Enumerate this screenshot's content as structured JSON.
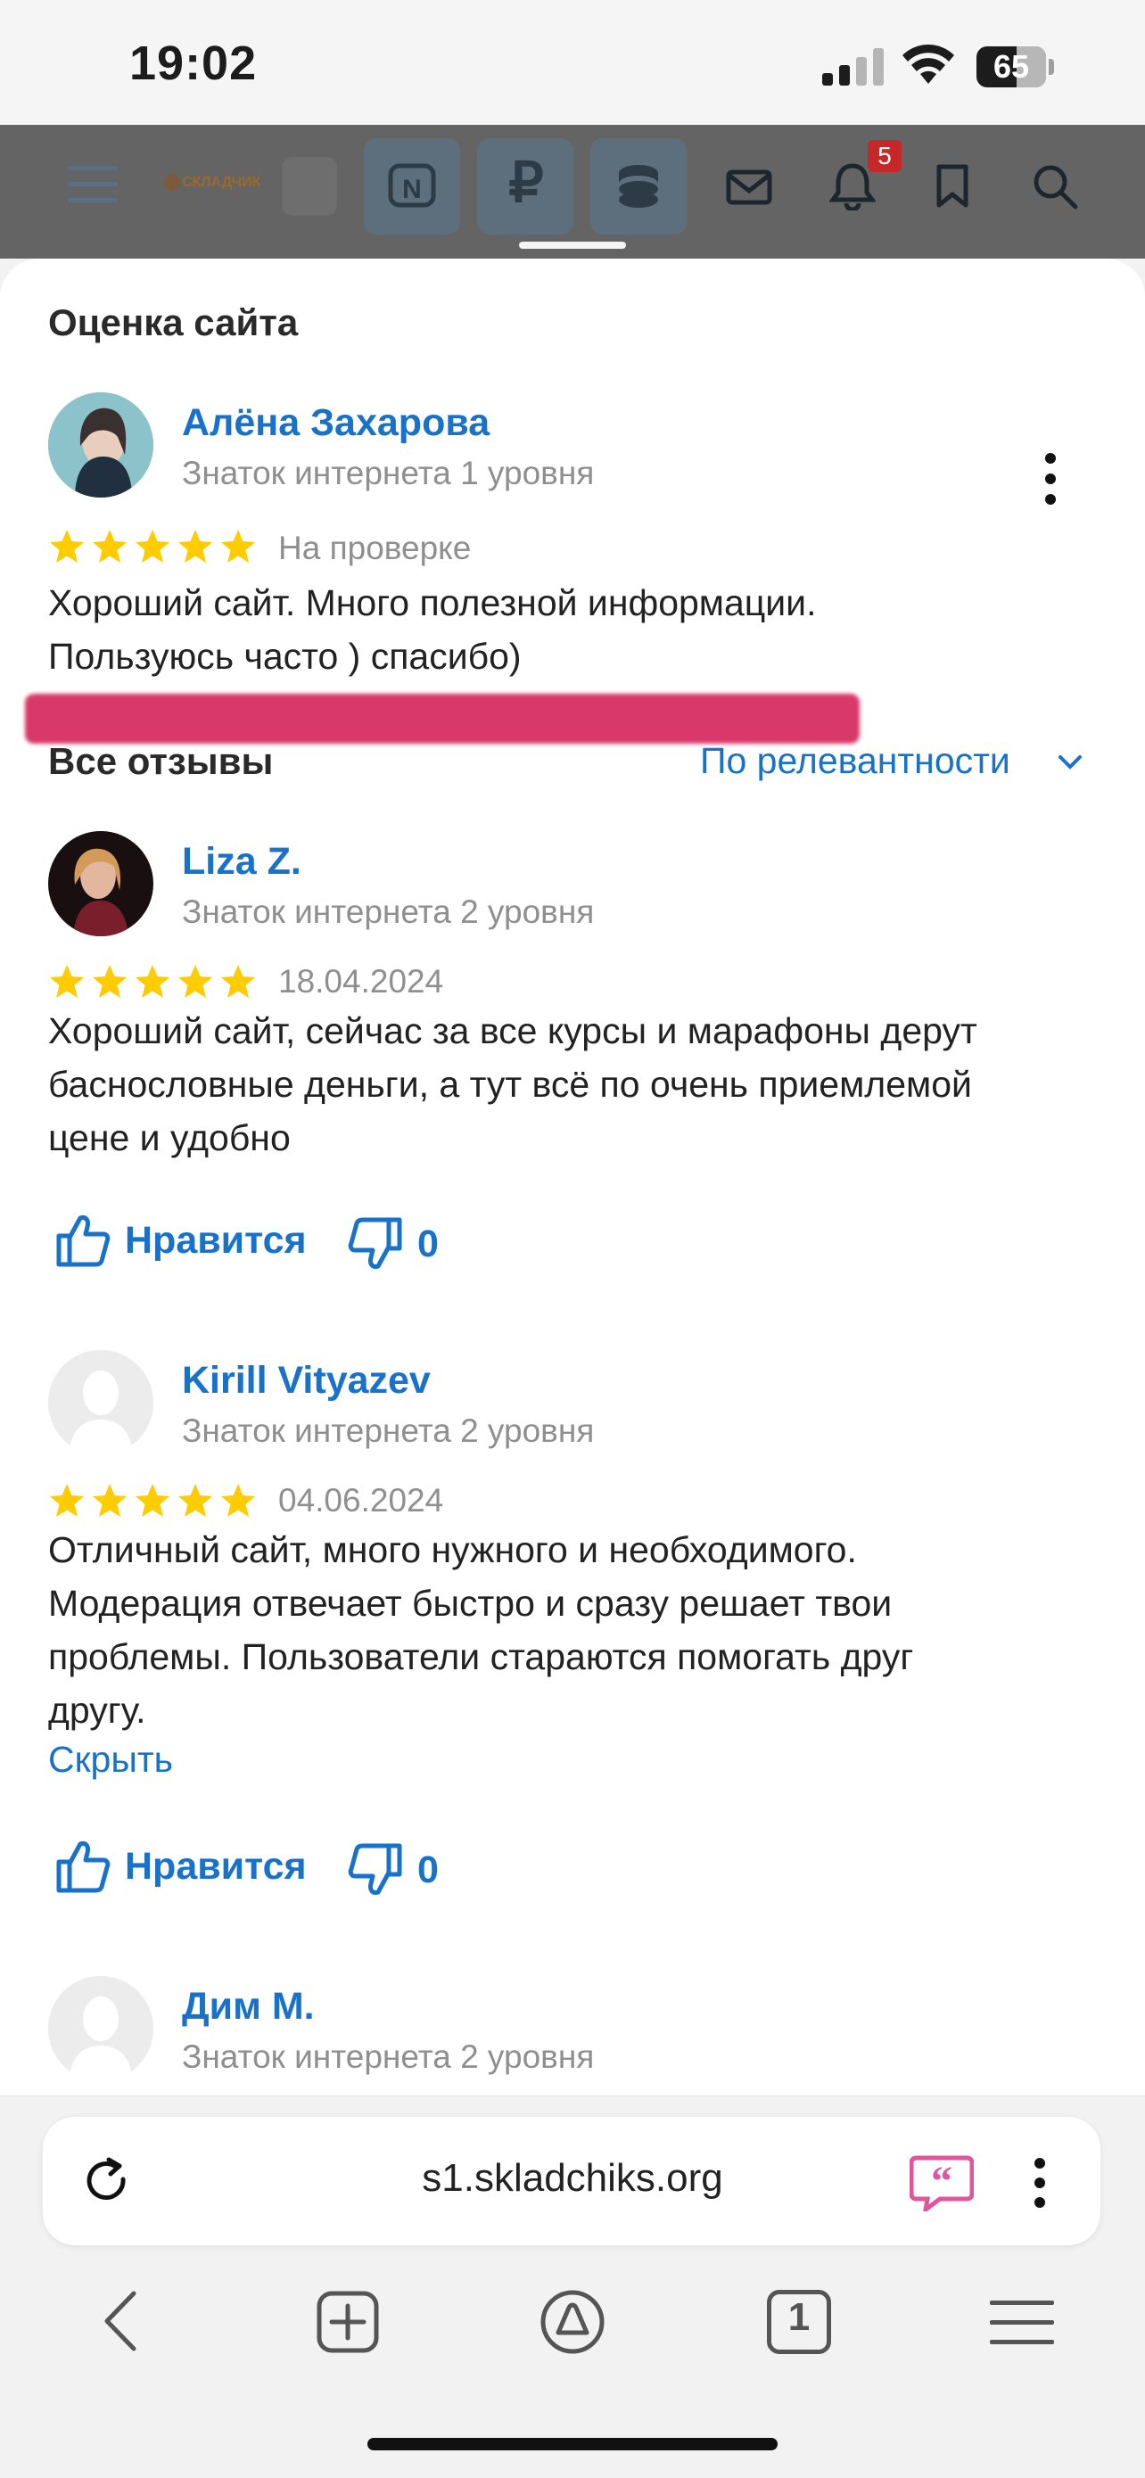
{
  "status_bar": {
    "time": "19:02",
    "battery": "65"
  },
  "site_header": {
    "logo_text": "СКЛАДЧИК",
    "notification_count": "5"
  },
  "sheet": {
    "rating_title": "Оценка сайта",
    "my_review": {
      "name": "Алёна Захарова",
      "level": "Знаток интернета 1 уровня",
      "rating": 5,
      "status": "На проверке",
      "text_line1": "Хороший сайт. Много полезной информации.",
      "text_line2": "Пользуюсь часто ) спасибо)"
    },
    "all_reviews_title": "Все отзывы",
    "sort_label": "По релевантности",
    "reviews": [
      {
        "name": "Liza Z.",
        "level": "Знаток интернета 2 уровня",
        "rating": 5,
        "date": "18.04.2024",
        "lines": [
          "Хороший сайт, сейчас за все курсы и марафоны дерут",
          "баснословные деньги, а тут всё по очень приемлемой",
          "цене и удобно"
        ],
        "like_label": "Нравится",
        "dislike_count": "0"
      },
      {
        "name": "Kirill Vityazev",
        "level": "Знаток интернета 2 уровня",
        "rating": 5,
        "date": "04.06.2024",
        "lines": [
          "Отличный сайт, много нужного и необходимого.",
          "Модерация отвечает быстро и сразу решает твои",
          "проблемы. Пользователи стараются помогать друг",
          "другу."
        ],
        "hide_label": "Скрыть",
        "like_label": "Нравится",
        "dislike_count": "0"
      },
      {
        "name": "Дим М.",
        "level": "Знаток интернета 2 уровня"
      }
    ]
  },
  "browser": {
    "url": "s1.skladchiks.org",
    "tab_count": "1"
  },
  "colors": {
    "accent": "#1972c9",
    "star": "#ffcc00",
    "notification_badge": "#d32f2f"
  }
}
